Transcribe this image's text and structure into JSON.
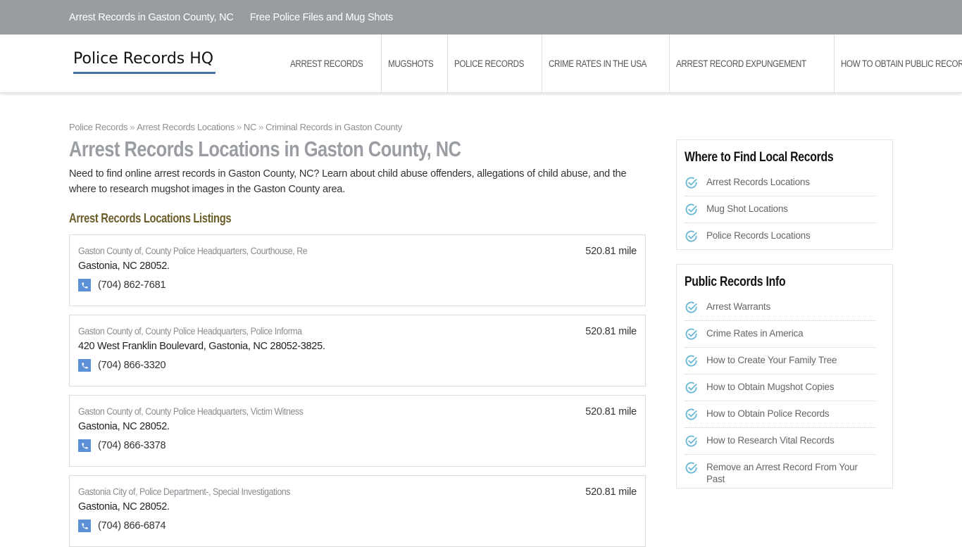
{
  "topbar": {
    "links": [
      "Arrest Records in Gaston County, NC",
      "Free Police Files and Mug Shots"
    ]
  },
  "header": {
    "logo": "Police Records HQ",
    "nav": [
      "ARREST RECORDS",
      "MUGSHOTS",
      "POLICE RECORDS",
      "CRIME RATES IN THE USA",
      "ARREST RECORD EXPUNGEMENT",
      "HOW TO OBTAIN PUBLIC RECORDS"
    ]
  },
  "breadcrumb": {
    "items": [
      "Police Records",
      "Arrest Records Locations",
      "NC",
      "Criminal Records in Gaston County"
    ],
    "separator": "»"
  },
  "main": {
    "title": "Arrest Records Locations in Gaston County, NC",
    "intro": "Need to find online arrest records in Gaston County, NC? Learn about child abuse offenders, allegations of child abuse, and the where to research mugshot images in the Gaston County area.",
    "section_title": "Arrest Records Locations Listings",
    "listings": [
      {
        "name": "Gaston County of, County Police Headquarters, Courthouse, Re",
        "address": "Gastonia, NC 28052.",
        "phone": "(704) 862-7681",
        "distance": "520.81 mile"
      },
      {
        "name": "Gaston County of, County Police Headquarters, Police Informa",
        "address": "420 West Franklin Boulevard, Gastonia, NC 28052-3825.",
        "phone": "(704) 866-3320",
        "distance": "520.81 mile"
      },
      {
        "name": "Gaston County of, County Police Headquarters, Victim Witness",
        "address": "Gastonia, NC 28052.",
        "phone": "(704) 866-3378",
        "distance": "520.81 mile"
      },
      {
        "name": "Gastonia City of, Police Department-, Special Investigations",
        "address": "Gastonia, NC 28052.",
        "phone": "(704) 866-6874",
        "distance": "520.81 mile"
      }
    ]
  },
  "sidebar": {
    "widgets": [
      {
        "title": "Where to Find Local Records",
        "items": [
          "Arrest Records Locations",
          "Mug Shot Locations",
          "Police Records Locations"
        ]
      },
      {
        "title": "Public Records Info",
        "items": [
          "Arrest Warrants",
          "Crime Rates in America",
          "How to Create Your Family Tree",
          "How to Obtain Mugshot Copies",
          "How to Obtain Police Records",
          "How to Research Vital Records",
          "Remove an Arrest Record From Your Past"
        ]
      }
    ]
  },
  "icons": {
    "phone": "phone-icon",
    "check": "check-circle-icon"
  },
  "colors": {
    "topbar_bg": "#9a9da0",
    "logo_underline": "#4672a6",
    "phone_icon_bg": "#5b8fd6",
    "check_icon": "#6bb8d4",
    "section_title": "#6b5e2a",
    "page_title": "#9a9ea3"
  }
}
